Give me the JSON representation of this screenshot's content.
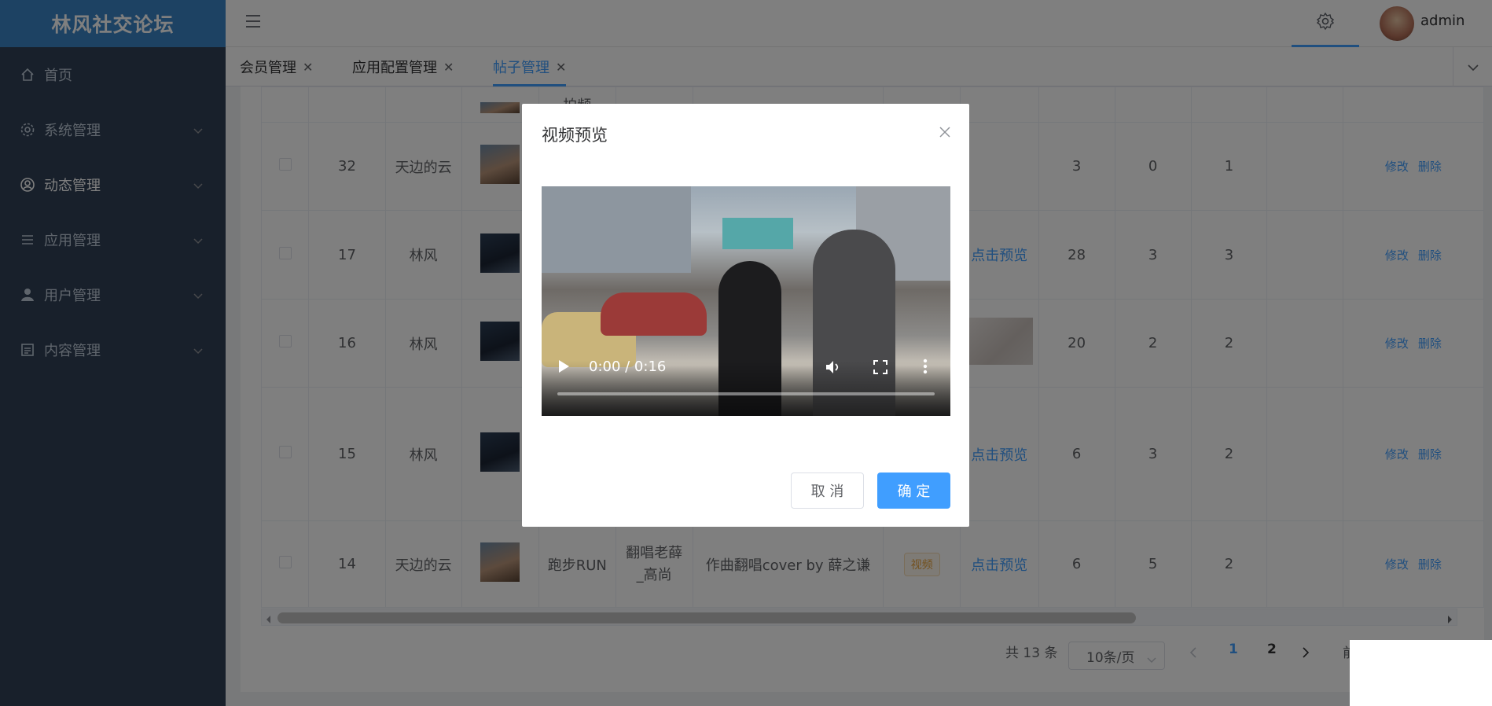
{
  "app": {
    "title": "林风社交论坛"
  },
  "sidebar": {
    "items": [
      {
        "label": "首页",
        "icon": "home-icon"
      },
      {
        "label": "系统管理",
        "icon": "gear-icon"
      },
      {
        "label": "动态管理",
        "icon": "user-circle-icon"
      },
      {
        "label": "应用管理",
        "icon": "list-icon"
      },
      {
        "label": "用户管理",
        "icon": "user-icon"
      },
      {
        "label": "内容管理",
        "icon": "picture-icon"
      }
    ]
  },
  "header": {
    "username": "admin"
  },
  "tabs": [
    {
      "label": "会员管理"
    },
    {
      "label": "应用配置管理"
    },
    {
      "label": "帖子管理",
      "active": true
    }
  ],
  "table": {
    "partial_top_text": "拍频",
    "rows": [
      {
        "id": "32",
        "author": "天边的云",
        "col5": "",
        "col6": "",
        "col7": "",
        "tag": "",
        "preview": "",
        "c1": "3",
        "c2": "0",
        "c3": "1"
      },
      {
        "id": "17",
        "author": "林风",
        "col5": "",
        "col6": "",
        "col7": "",
        "tag": "",
        "preview": "点击预览",
        "c1": "28",
        "c2": "3",
        "c3": "3"
      },
      {
        "id": "16",
        "author": "林风",
        "col5": "",
        "col6": "",
        "col7": "",
        "tag": "",
        "preview": "",
        "c1": "20",
        "c2": "2",
        "c3": "2"
      },
      {
        "id": "15",
        "author": "林风",
        "col5": "",
        "col6": "",
        "col7": "",
        "tag": "",
        "preview": "点击预览",
        "c1": "6",
        "c2": "3",
        "c3": "2"
      },
      {
        "id": "14",
        "author": "天边的云",
        "col5": "跑步RUN",
        "col6": "翻唱老薛_高尚",
        "col7": "作曲翻唱cover by 薛之谦",
        "tag": "视频",
        "preview": "点击预览",
        "c1": "6",
        "c2": "5",
        "c3": "2"
      }
    ],
    "actions": {
      "edit": "修改",
      "delete": "删除"
    }
  },
  "pagination": {
    "total": "共 13 条",
    "page_size": "10条/页",
    "pages": [
      "1",
      "2"
    ],
    "current": "1",
    "goto": "前"
  },
  "dialog": {
    "title": "视频预览",
    "video_time": "0:00 / 0:16",
    "video_progress": 0.0,
    "cancel": "取 消",
    "ok": "确 定"
  },
  "colors": {
    "primary": "#409eff",
    "sidebar": "#304156",
    "logo_bg": "#3a85c6"
  }
}
